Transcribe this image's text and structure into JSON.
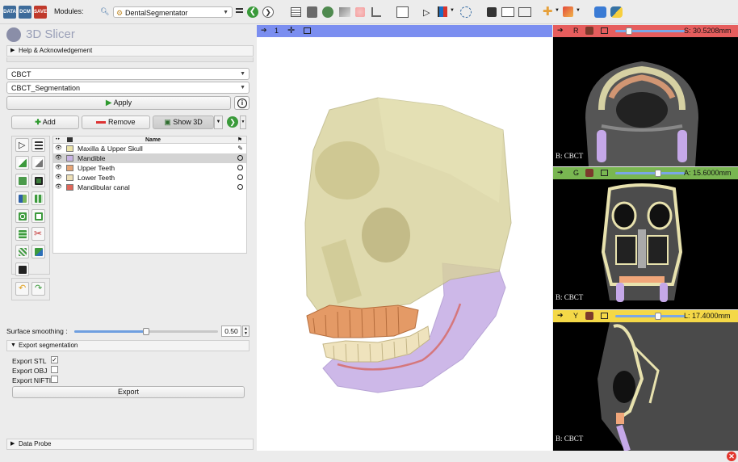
{
  "toolbar": {
    "data_label": "DATA",
    "dcm_label": "DCM",
    "save_label": "SAVE",
    "modules_label": "Modules:",
    "module_selected": "DentalSegmentator"
  },
  "app": {
    "title": "3D Slicer"
  },
  "panels": {
    "help": "Help & Acknowledgement",
    "export": "Export segmentation",
    "data_probe": "Data Probe"
  },
  "selectors": {
    "volume": "CBCT",
    "segmentation": "CBCT_Segmentation"
  },
  "buttons": {
    "apply": "Apply",
    "add": "Add",
    "remove": "Remove",
    "show3d": "Show 3D",
    "export": "Export"
  },
  "table": {
    "header_name": "Name",
    "segments": [
      {
        "name": "Maxilla & Upper Skull",
        "color": "#ece4a8",
        "selected": false
      },
      {
        "name": "Mandible",
        "color": "#c9b4e4",
        "selected": true
      },
      {
        "name": "Upper Teeth",
        "color": "#e8a575",
        "selected": false
      },
      {
        "name": "Lower Teeth",
        "color": "#eedfb6",
        "selected": false
      },
      {
        "name": "Mandibular canal",
        "color": "#e0675a",
        "selected": false
      }
    ]
  },
  "smoothing": {
    "label": "Surface smoothing :",
    "value": "0.50",
    "fraction": 0.5
  },
  "export": {
    "stl_label": "Export STL",
    "stl_checked": true,
    "obj_label": "Export OBJ",
    "obj_checked": false,
    "nifti_label": "Export NIFTI",
    "nifti_checked": false
  },
  "view3d": {
    "number": "1",
    "header_color": "#7b8ef0"
  },
  "views": {
    "red": {
      "letter": "R",
      "offset": "S: 30.5208mm",
      "bg_label": "B: CBCT",
      "color": "#e65d5d",
      "slider_fraction": 0.2
    },
    "green": {
      "letter": "G",
      "offset": "A: 15.6000mm",
      "bg_label": "B: CBCT",
      "color": "#79b651",
      "slider_fraction": 0.62
    },
    "yellow": {
      "letter": "Y",
      "offset": "L: 17.4000mm",
      "bg_label": "B: CBCT",
      "color": "#f4d847",
      "slider_fraction": 0.62
    }
  }
}
